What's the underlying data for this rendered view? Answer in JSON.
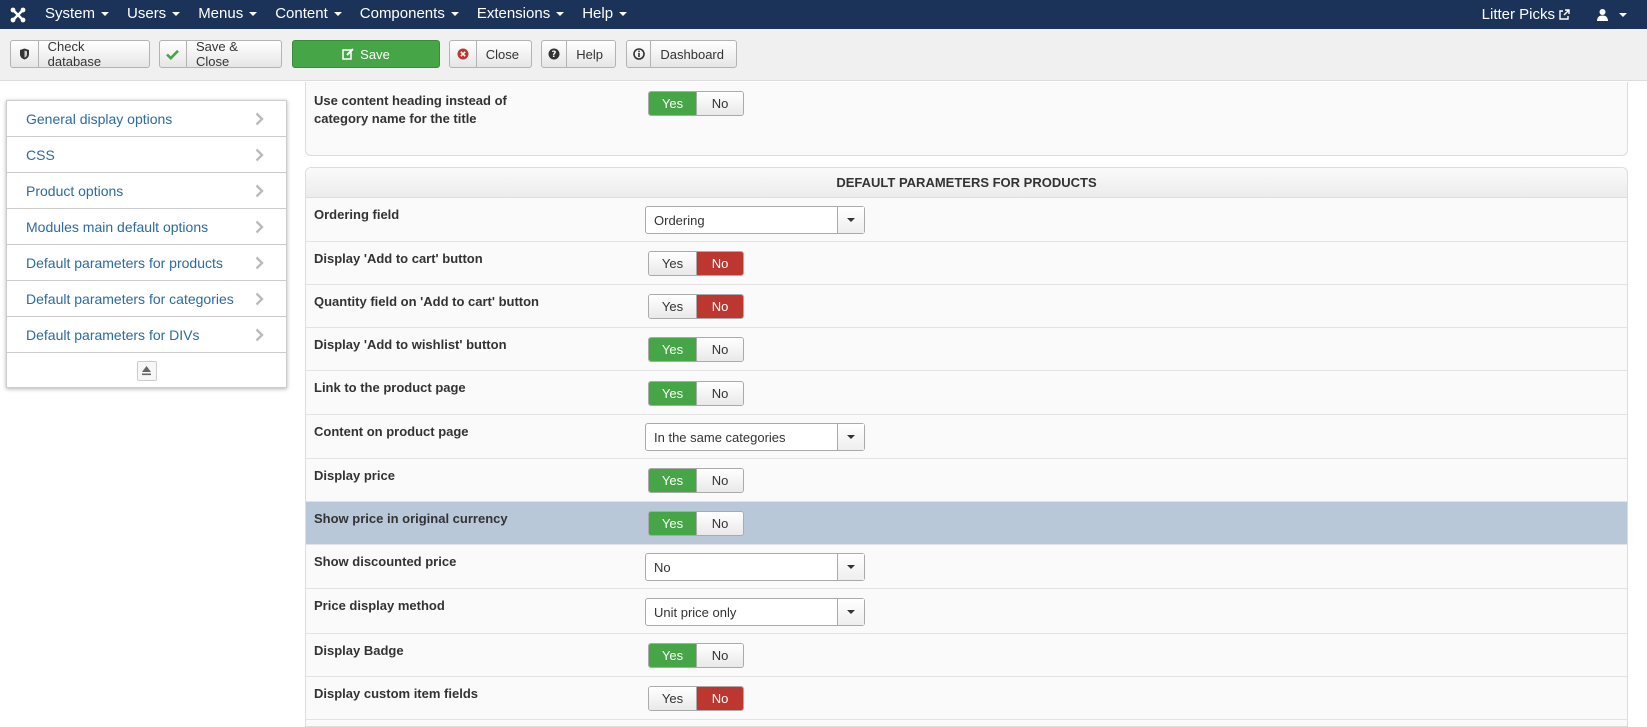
{
  "navbar": {
    "menu": [
      "System",
      "Users",
      "Menus",
      "Content",
      "Components",
      "Extensions",
      "Help"
    ],
    "site_name": "Litter Picks"
  },
  "toolbar": {
    "check_database": "Check database",
    "save_close": "Save & Close",
    "save": "Save",
    "close": "Close",
    "help": "Help",
    "dashboard": "Dashboard"
  },
  "sidebar": {
    "items": [
      "General display options",
      "CSS",
      "Product options",
      "Modules main default options",
      "Default parameters for products",
      "Default parameters for categories",
      "Default parameters for DIVs"
    ]
  },
  "top_panel": {
    "label": "Use content heading instead of category name for the title",
    "yes": "Yes",
    "no": "No"
  },
  "section": {
    "title": "DEFAULT PARAMETERS FOR PRODUCTS",
    "rows": [
      {
        "label": "Ordering field",
        "type": "select",
        "value": "Ordering"
      },
      {
        "label": "Display 'Add to cart' button",
        "type": "toggle",
        "value": "No"
      },
      {
        "label": "Quantity field on 'Add to cart' button",
        "type": "toggle",
        "value": "No"
      },
      {
        "label": "Display 'Add to wishlist' button",
        "type": "toggle",
        "value": "Yes"
      },
      {
        "label": "Link to the product page",
        "type": "toggle",
        "value": "Yes"
      },
      {
        "label": "Content on product page",
        "type": "select",
        "value": "In the same categories"
      },
      {
        "label": "Display price",
        "type": "toggle",
        "value": "Yes"
      },
      {
        "label": "Show price in original currency",
        "type": "toggle",
        "value": "Yes"
      },
      {
        "label": "Show discounted price",
        "type": "select",
        "value": "No"
      },
      {
        "label": "Price display method",
        "type": "select",
        "value": "Unit price only"
      },
      {
        "label": "Display Badge",
        "type": "toggle",
        "value": "Yes"
      },
      {
        "label": "Display custom item fields",
        "type": "toggle",
        "value": "No"
      }
    ],
    "yes_label": "Yes",
    "no_label": "No"
  },
  "colors": {
    "navbar": "#1b3259",
    "yes_active": "#46a546",
    "no_active": "#bd362f",
    "link": "#2b6aa3",
    "highlight_row": "#b9c8d9"
  }
}
